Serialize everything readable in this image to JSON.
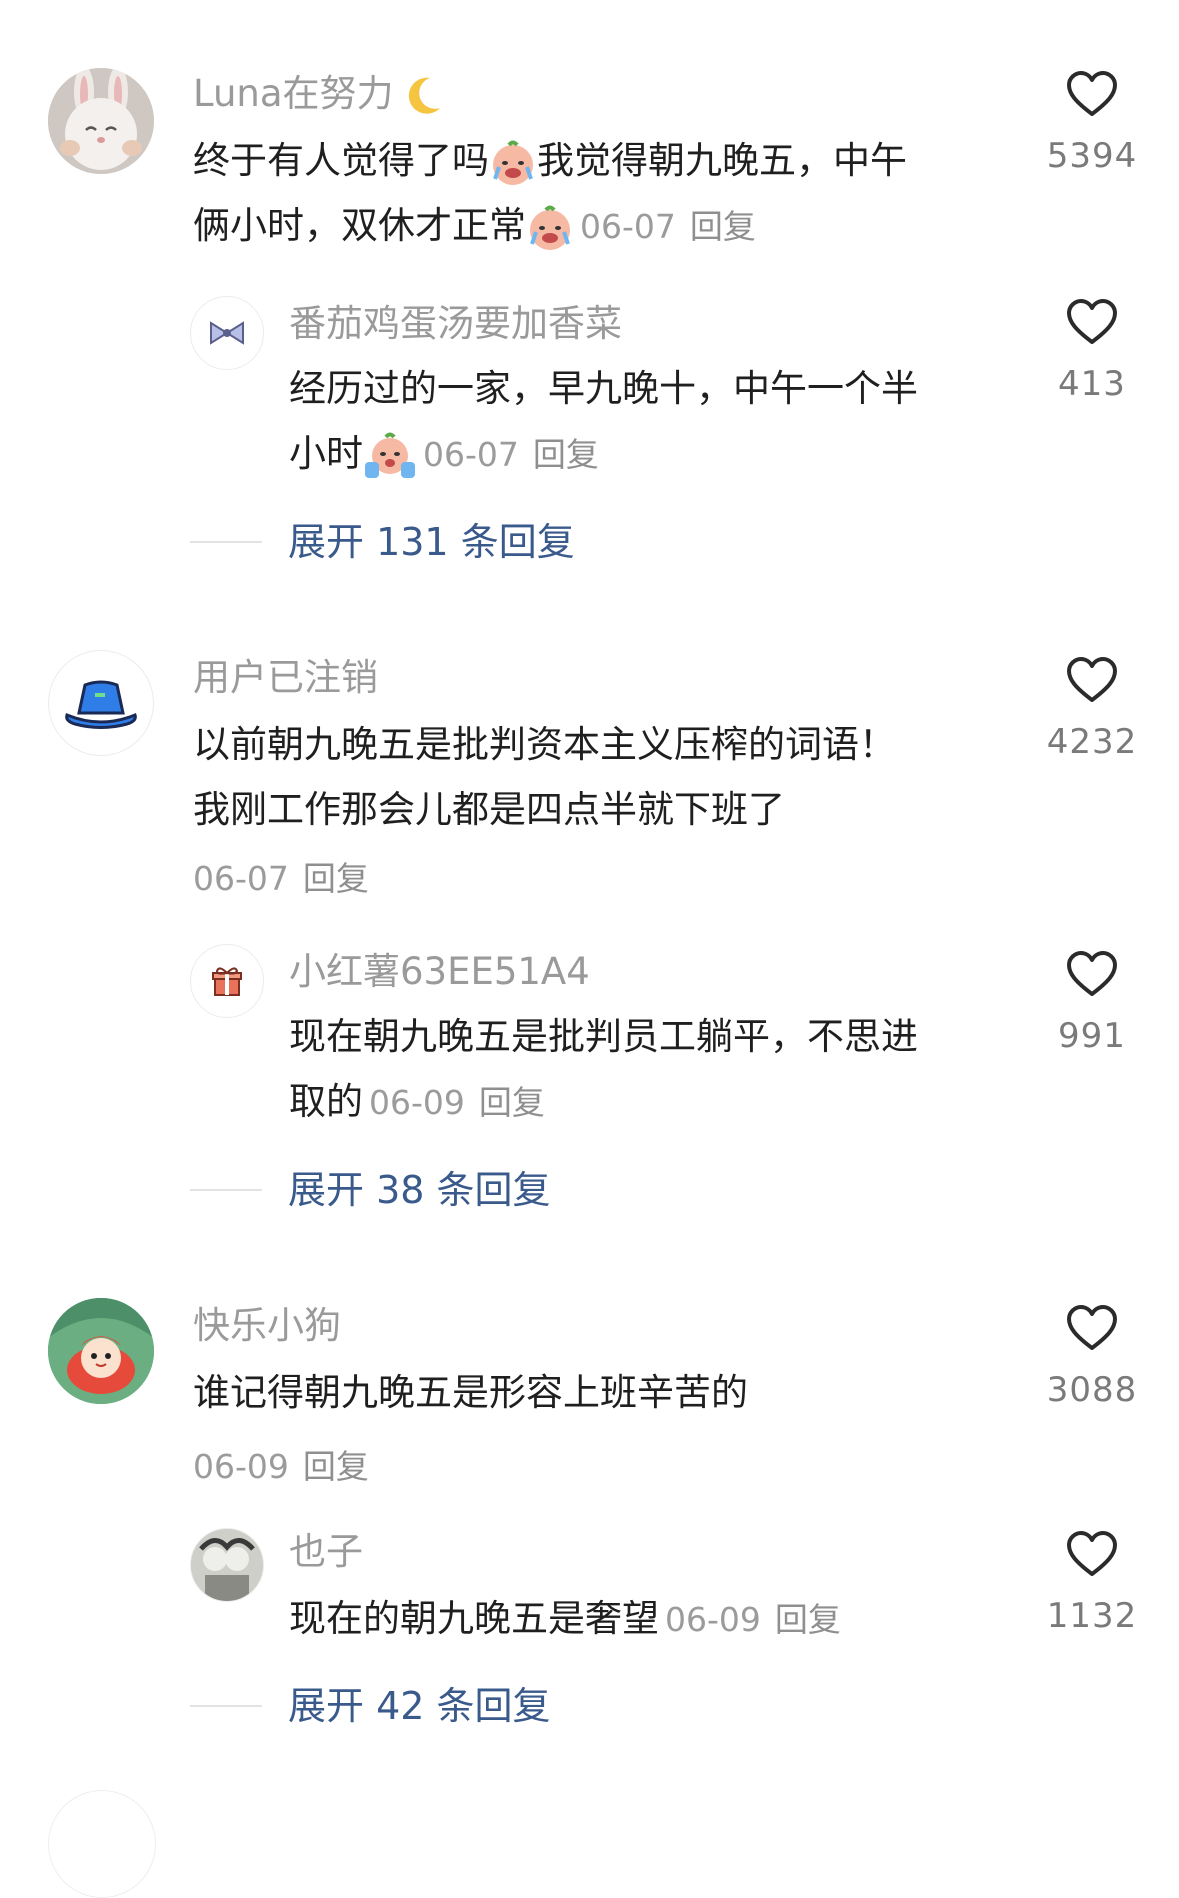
{
  "comments": [
    {
      "name": "Luna在努力",
      "text1": "终于有人觉得了吗",
      "text2": "我觉得朝九晚五，中午",
      "text3": "俩小时，双休才正常",
      "date": "06-07",
      "reply": "回复",
      "likes": "5394",
      "avatar_icon": "bunny-avatar-icon"
    },
    {
      "name": "用户已注销",
      "text1": "以前朝九晚五是批判资本主义压榨的词语！",
      "text2": "我刚工作那会儿都是四点半就下班了",
      "date": "06-07",
      "reply": "回复",
      "likes": "4232",
      "avatar_icon": "bucket-hat-icon"
    },
    {
      "name": "快乐小狗",
      "text1": "谁记得朝九晚五是形容上班辛苦的",
      "date": "06-09",
      "reply": "回复",
      "likes": "3088",
      "avatar_icon": "ponyo-avatar-icon"
    }
  ],
  "replies": [
    {
      "name": "番茄鸡蛋汤要加香菜",
      "text1": "经历过的一家，早九晚十，中午一个半",
      "text2": "小时",
      "date": "06-07",
      "reply": "回复",
      "likes": "413",
      "avatar_icon": "bow-icon"
    },
    {
      "name": "小红薯63EE51A4",
      "text1": "现在朝九晚五是批判员工躺平，不思进",
      "text2": "取的",
      "date": "06-09",
      "reply": "回复",
      "likes": "991",
      "avatar_icon": "gift-icon"
    },
    {
      "name": "也子",
      "text1": "现在的朝九晚五是奢望",
      "date": "06-09",
      "reply": "回复",
      "likes": "1132",
      "avatar_icon": "photo-avatar-icon"
    }
  ],
  "expand": [
    {
      "label": "展开 131 条回复"
    },
    {
      "label": "展开 38 条回复"
    },
    {
      "label": "展开 42 条回复"
    }
  ],
  "colors": {
    "name": "#9a9a9a",
    "text": "#1f1f1f",
    "expand": "#3a5a8c",
    "heart": "#2b2b2b"
  }
}
